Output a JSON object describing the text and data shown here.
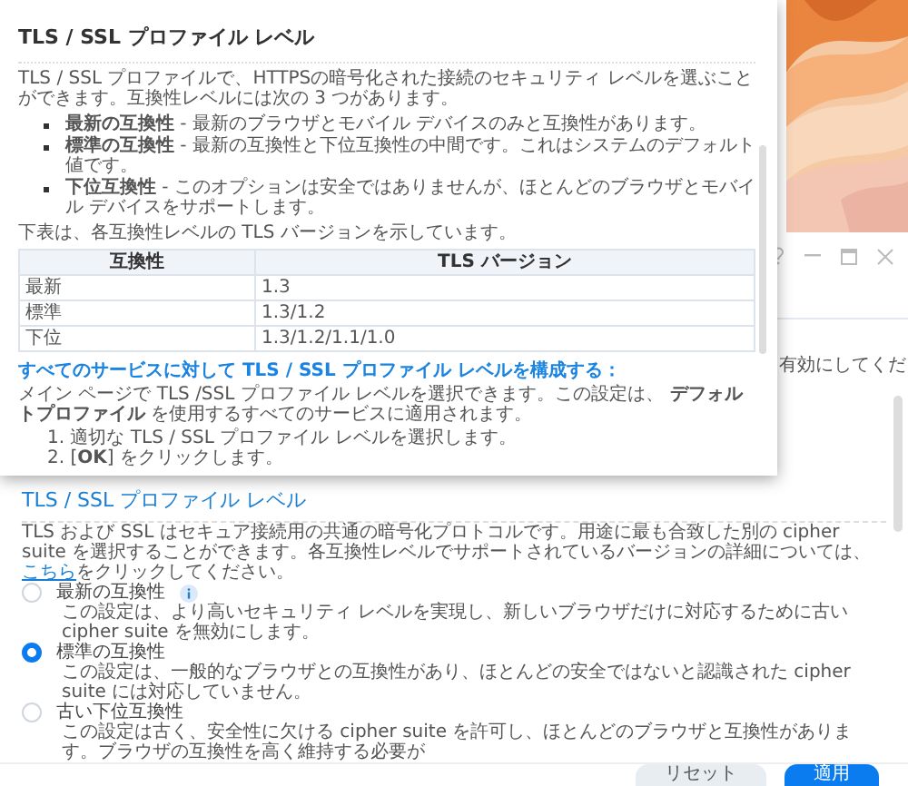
{
  "help_popup": {
    "title": "TLS / SSL プロファイル レベル",
    "intro": "TLS / SSL プロファイルで、HTTPSの暗号化された接続のセキュリティ レベルを選ぶことができます。互換性レベルには次の 3 つがあります。",
    "bullets": [
      "**最新の互換性** - 最新のブラウザとモバイル デバイスのみと互換性があります。",
      "**標準の互換性** - 最新の互換性と下位互換性の中間です。これはシステムのデフォルト値です。",
      "**下位互換性** - このオプションは安全ではありませんが、ほとんどのブラウザとモバイル デバイスをサポートします。"
    ],
    "table_caption": "下表は、各互換性レベルの TLS バージョンを示しています。",
    "table": {
      "columns": [
        "互換性",
        "TLS バージョン"
      ],
      "rows": [
        [
          "最新",
          "1.3"
        ],
        [
          "標準",
          "1.3/1.2"
        ],
        [
          "下位",
          "1.3/1.2/1.1/1.0"
        ]
      ]
    },
    "section_heading": "すべてのサービスに対して TLS / SSL プロファイル レベルを構成する：",
    "section_text": "メイン ページで TLS /SSL プロファイル レベルを選択できます。この設定は、 **デフォルトプロファイル** を使用するすべてのサービスに適用されます。",
    "steps": [
      "1. 適切な TLS / SSL プロファイル レベルを選択します。",
      "2. [**OK**] をクリックします。"
    ]
  },
  "window": {
    "partial_text": "有効にしてくだ",
    "section": {
      "title": "TLS / SSL プロファイル レベル",
      "text_before_link": "TLS および SSL はセキュア接続用の共通の暗号化プロトコルです。用途に最も合致した別の cipher suite を選択することができます。各互換性レベルでサポートされているバージョンの詳細については、",
      "link": "こちら",
      "text_after_link": "をクリックしてください。"
    },
    "options": [
      {
        "label": "最新の互換性",
        "selected": false,
        "info": true,
        "description": "この設定は、より高いセキュリティ レベルを実現し、新しいブラウザだけに対応するために古い cipher suite を無効にします。"
      },
      {
        "label": "標準の互換性",
        "selected": true,
        "info": false,
        "description": "この設定は、一般的なブラウザとの互換性があり、ほとんどの安全ではないと認識された cipher suite には対応していません。"
      },
      {
        "label": "古い下位互換性",
        "selected": false,
        "info": false,
        "description": "この設定は古く、安全性に欠ける cipher suite を許可し、ほとんどのブラウザと互換性があります。ブラウザの互換性を高く維持する必要が"
      }
    ],
    "buttons": [
      {
        "label": "リセット",
        "kind": "secondary"
      },
      {
        "label": "適用",
        "kind": "primary"
      }
    ]
  }
}
